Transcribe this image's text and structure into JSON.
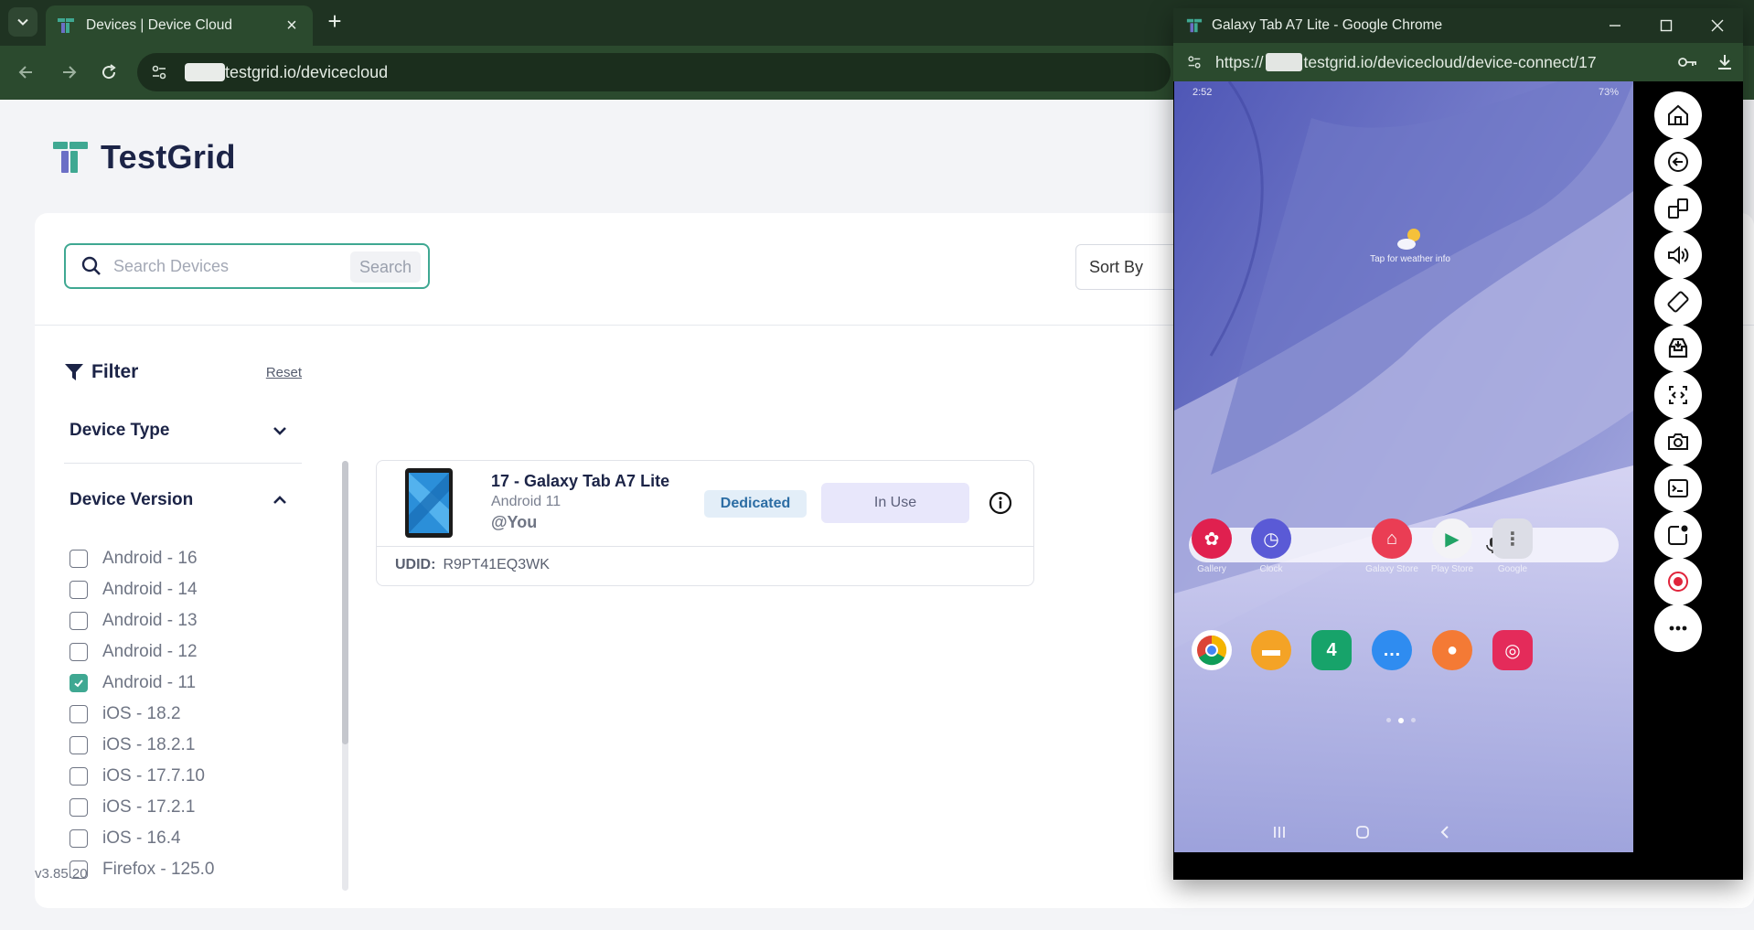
{
  "browser": {
    "tab_title": "Devices | Device Cloud",
    "url_suffix": "testgrid.io/devicecloud"
  },
  "page": {
    "logo_text": "TestGrid",
    "search": {
      "placeholder": "Search Devices",
      "button_label": "Search"
    },
    "sort_label": "Sort By",
    "filter": {
      "title": "Filter",
      "reset_label": "Reset",
      "device_type_label": "Device Type",
      "device_version_label": "Device Version",
      "versions": [
        {
          "label": "Android - 16",
          "checked": false
        },
        {
          "label": "Android - 14",
          "checked": false
        },
        {
          "label": "Android - 13",
          "checked": false
        },
        {
          "label": "Android - 12",
          "checked": false
        },
        {
          "label": "Android - 11",
          "checked": true
        },
        {
          "label": "iOS - 18.2",
          "checked": false
        },
        {
          "label": "iOS - 18.2.1",
          "checked": false
        },
        {
          "label": "iOS - 17.7.10",
          "checked": false
        },
        {
          "label": "iOS - 17.2.1",
          "checked": false
        },
        {
          "label": "iOS - 16.4",
          "checked": false
        },
        {
          "label": "Firefox - 125.0",
          "checked": false
        }
      ]
    },
    "app_version": "v3.85.20",
    "device_card": {
      "name": "17 - Galaxy Tab A7 Lite",
      "os": "Android 11",
      "user": "@You",
      "badge_dedicated": "Dedicated",
      "badge_status": "In Use",
      "udid_label": "UDID:",
      "udid_value": "R9PT41EQ3WK"
    }
  },
  "popup": {
    "title": "Galaxy Tab A7 Lite - Google Chrome",
    "url_prefix": "https://",
    "url_suffix": "testgrid.io/devicecloud/device-connect/17",
    "tablet": {
      "status_time": "2:52",
      "status_battery": "73%",
      "weather_text": "Tap for weather info",
      "apps_row1": [
        {
          "label": "Gallery",
          "color": "#e0204f",
          "glyph": "✿"
        },
        {
          "label": "Clock",
          "color": "#5a5ad6",
          "glyph": "◷"
        },
        {
          "label": "Galaxy Store",
          "color": "#ea3d54",
          "glyph": "⌂"
        },
        {
          "label": "Play Store",
          "color": "#f3f3f6",
          "glyph": "▶"
        },
        {
          "label": "Google",
          "color": "#dcdde6",
          "glyph": "⋮"
        }
      ],
      "apps_dock": [
        {
          "name": "chrome",
          "color": "#ffffff",
          "glyph": "◉"
        },
        {
          "name": "my-files",
          "color": "#f4a326",
          "glyph": "▬"
        },
        {
          "name": "calendar",
          "color": "#17a36a",
          "glyph": "4"
        },
        {
          "name": "messages",
          "color": "#2f8cf0",
          "glyph": "…"
        },
        {
          "name": "contacts",
          "color": "#f47a35",
          "glyph": "●"
        },
        {
          "name": "camera",
          "color": "#e42b5a",
          "glyph": "◎"
        }
      ]
    },
    "tools": [
      "home",
      "back",
      "app-switch",
      "volume",
      "rotate",
      "install-app",
      "inspect",
      "screenshot",
      "terminal",
      "notification",
      "record",
      "more"
    ]
  },
  "colors": {
    "accent": "#3fa892",
    "brand_navy": "#1c2447",
    "chrome_dark": "#1f3322",
    "chrome_mid": "#2b4a2e"
  }
}
